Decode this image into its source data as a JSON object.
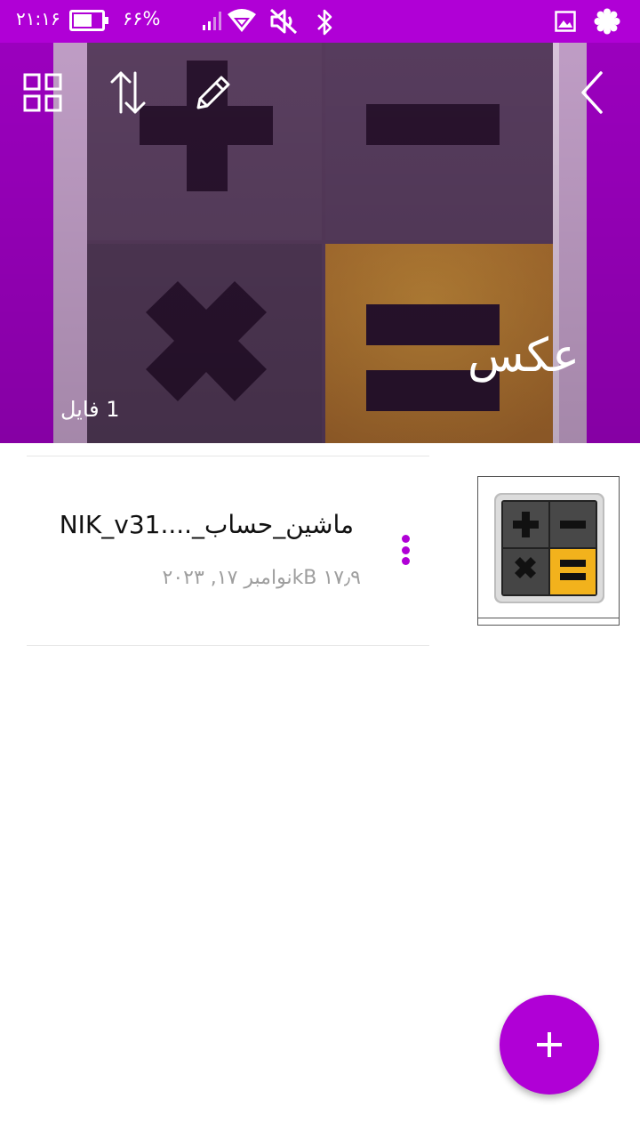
{
  "status_bar": {
    "time": "۲۱:۱۶",
    "battery_percent": "۶۶%",
    "battery_level": 0.66
  },
  "header": {
    "title": "عکس",
    "file_count": "1 فایل",
    "accent_color": "#b000d6"
  },
  "toolbar": {
    "icons": [
      "grid-view-icon",
      "sort-icon",
      "edit-icon",
      "back-arrow-icon"
    ]
  },
  "files": [
    {
      "name": "ماشین_حساب_....NIK_v31",
      "size": "۱۷٫۹ kB",
      "date": "نوامبر ۱۷, ۲۰۲۳"
    }
  ],
  "fab": {
    "icon": "plus-icon"
  }
}
